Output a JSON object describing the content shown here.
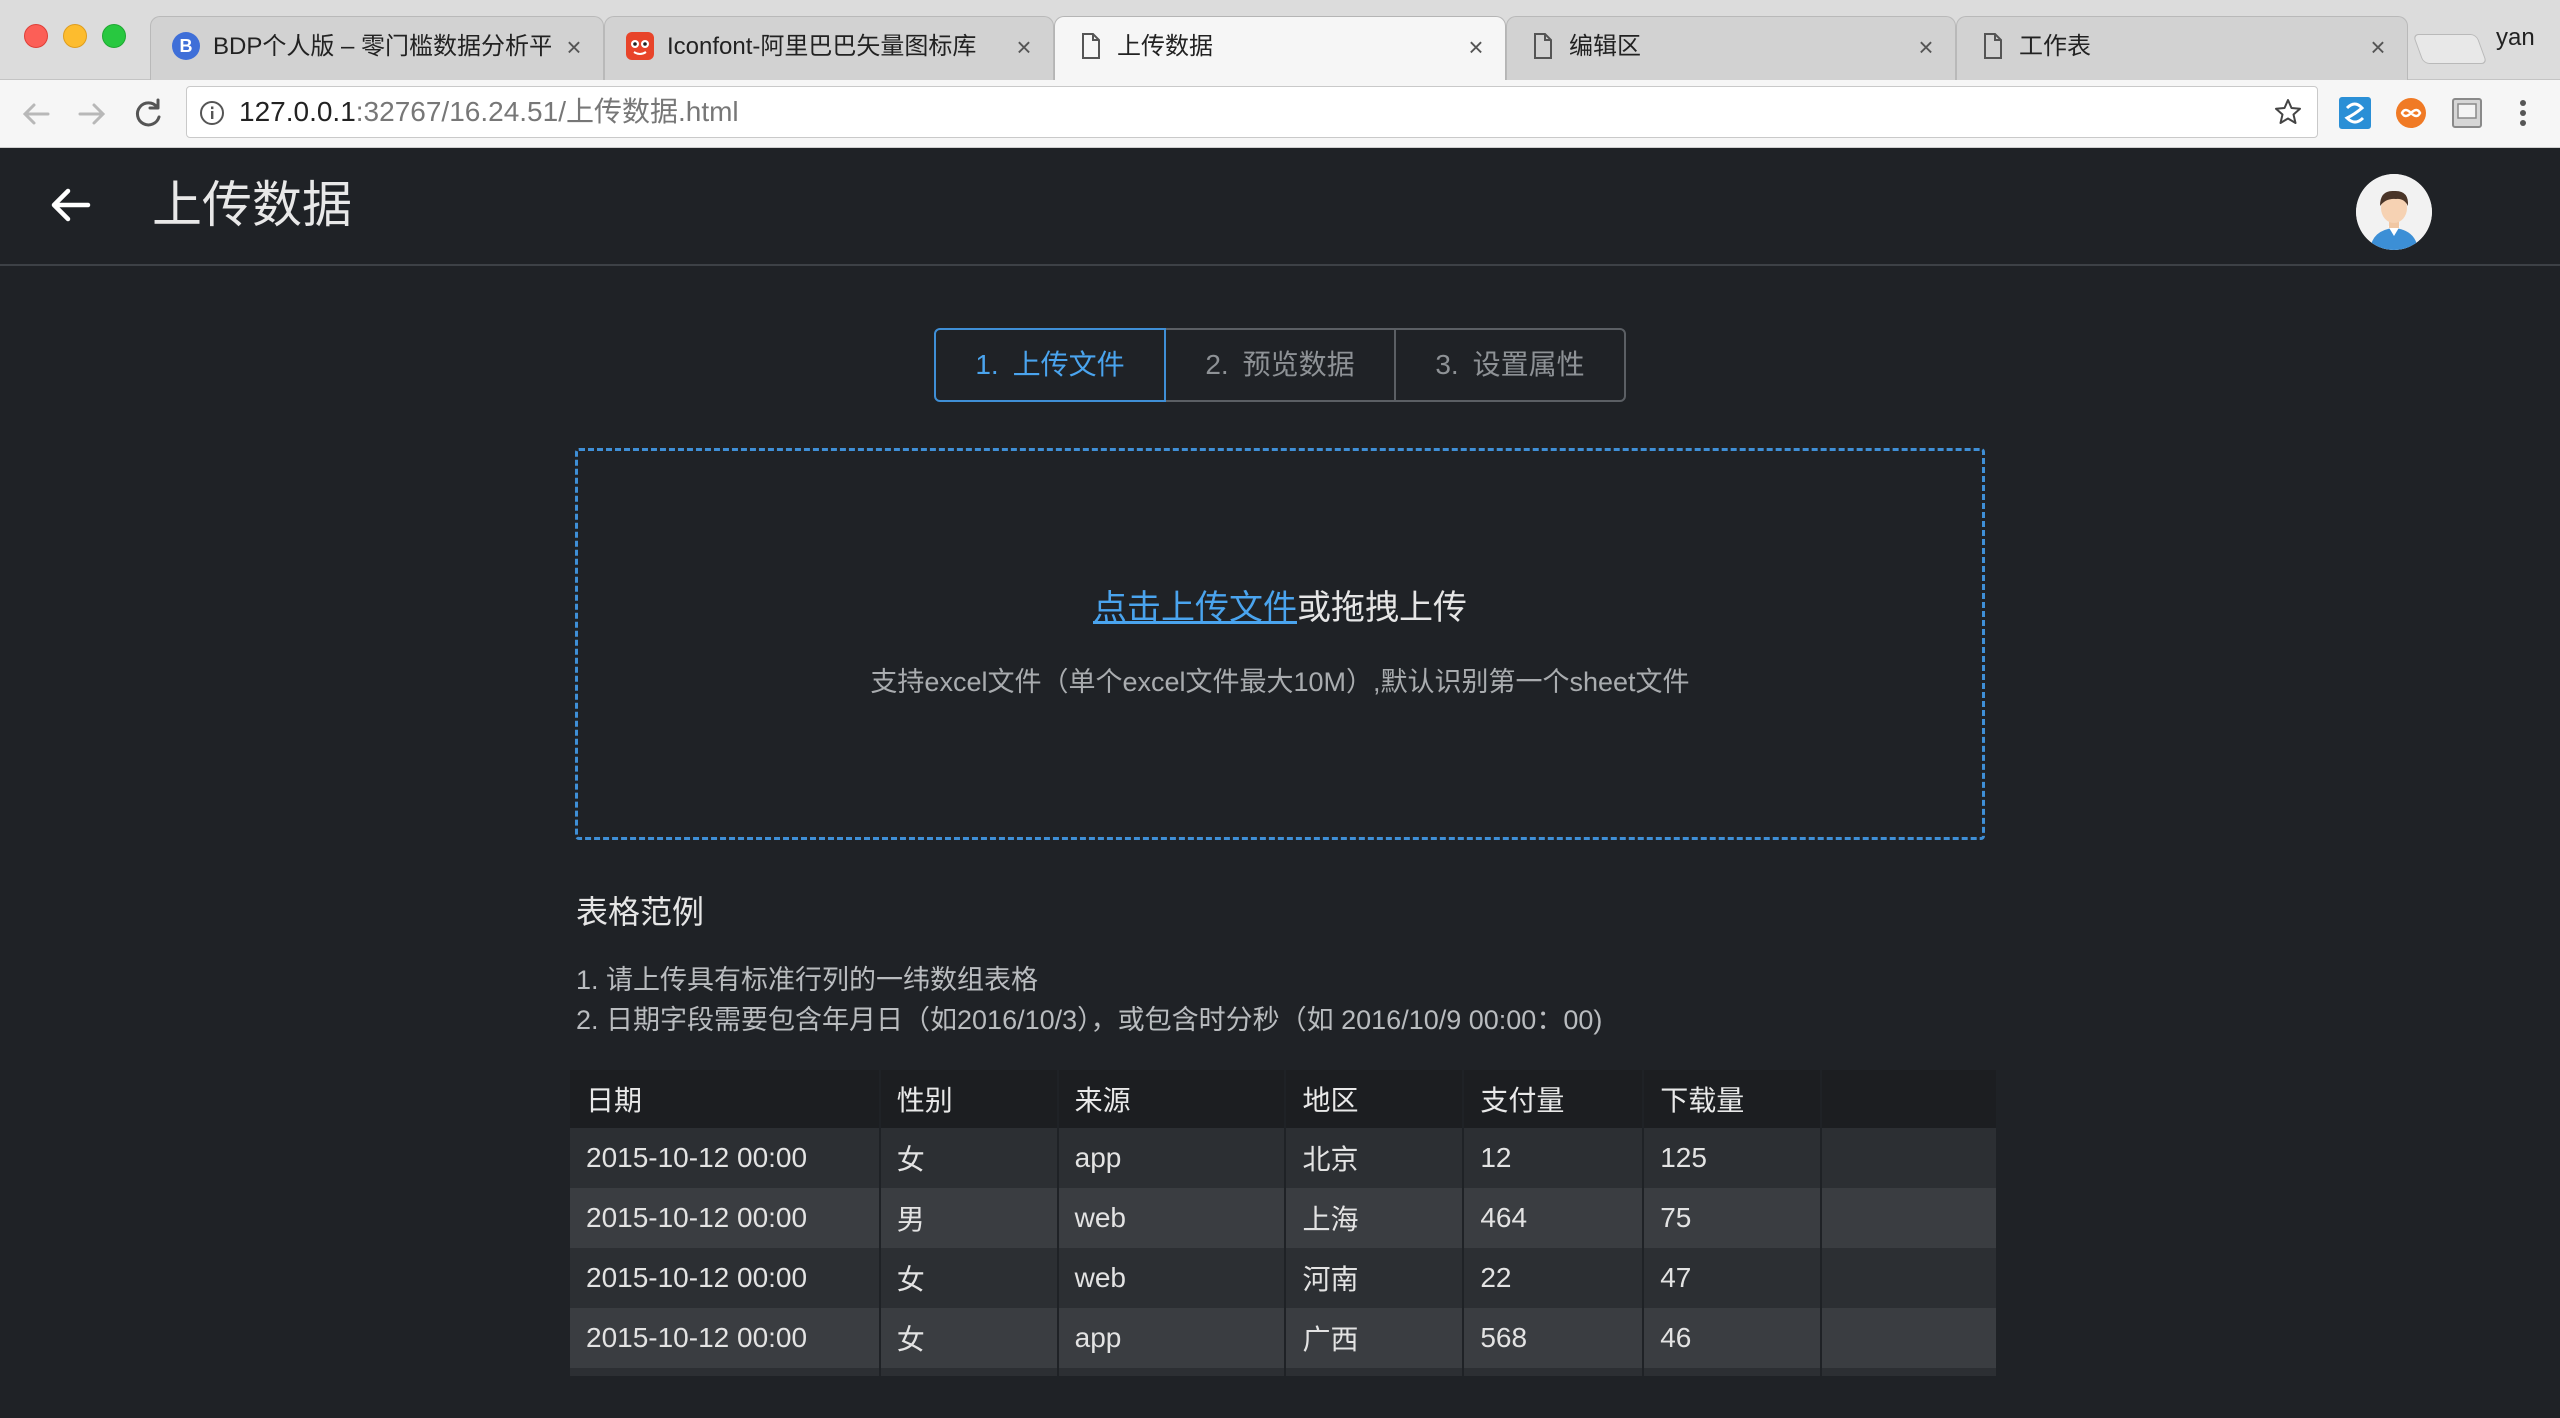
{
  "browser": {
    "tabs": [
      {
        "title": "BDP个人版 – 零门槛数据分析平",
        "icon": "bdp-favicon-icon",
        "active": false
      },
      {
        "title": "Iconfont-阿里巴巴矢量图标库",
        "icon": "iconfont-favicon-icon",
        "active": false
      },
      {
        "title": "上传数据",
        "icon": "document-icon",
        "active": true
      },
      {
        "title": "编辑区",
        "icon": "document-icon",
        "active": false
      },
      {
        "title": "工作表",
        "icon": "document-icon",
        "active": false
      }
    ],
    "close_glyph": "×",
    "profile_name": "yan",
    "url_host": "127.0.0.1",
    "url_rest": ":32767/16.24.51/上传数据.html"
  },
  "header": {
    "title": "上传数据"
  },
  "steps": [
    {
      "num": "1.",
      "label": "上传文件",
      "active": true
    },
    {
      "num": "2.",
      "label": "预览数据",
      "active": false
    },
    {
      "num": "3.",
      "label": "设置属性",
      "active": false
    }
  ],
  "upload": {
    "link_text": "点击上传文件",
    "suffix_text": "或拖拽上传",
    "hint": "支持excel文件（单个excel文件最大10M）,默认识别第一个sheet文件"
  },
  "example": {
    "title": "表格范例",
    "notes": [
      "1.  请上传具有标准行列的一纬数组表格",
      "2. 日期字段需要包含年月日（如2016/10/3），或包含时分秒（如 2016/10/9   00:00：00)"
    ],
    "columns": [
      "日期",
      "性别",
      "来源",
      "地区",
      "支付量",
      "下载量",
      ""
    ],
    "rows": [
      [
        "2015-10-12 00:00",
        "女",
        "app",
        "北京",
        "12",
        "125",
        ""
      ],
      [
        "2015-10-12 00:00",
        "男",
        "web",
        "上海",
        "464",
        "75",
        ""
      ],
      [
        "2015-10-12 00:00",
        "女",
        "web",
        "河南",
        "22",
        "47",
        ""
      ],
      [
        "2015-10-12 00:00",
        "女",
        "app",
        "广西",
        "568",
        "46",
        ""
      ]
    ]
  },
  "colors": {
    "accent": "#4aa4ee",
    "page_bg": "#1f2226",
    "row_odd": "#2c2f33",
    "row_even": "#3a3d41"
  }
}
